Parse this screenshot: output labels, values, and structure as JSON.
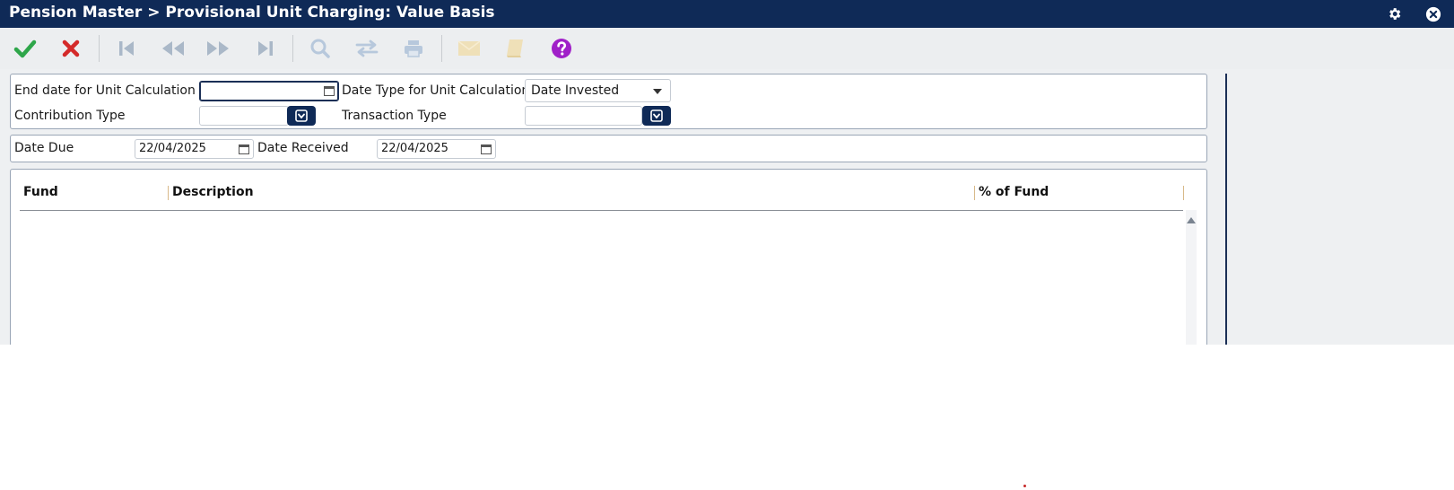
{
  "window": {
    "title": "Pension Master > Provisional Unit Charging: Value Basis"
  },
  "titlebar_icons": [
    "gear-icon",
    "close-circle-icon"
  ],
  "toolbar": {
    "buttons": [
      {
        "name": "accept-button",
        "icon": "checkmark-icon",
        "color": "#2ea64a",
        "enabled": true
      },
      {
        "name": "cancel-button",
        "icon": "x-icon",
        "color": "#d42a2a",
        "enabled": true
      },
      {
        "name": "first-record-button",
        "icon": "skip-first-icon",
        "color": "#aab8c8",
        "enabled": false
      },
      {
        "name": "previous-record-button",
        "icon": "rewind-icon",
        "color": "#aab8c8",
        "enabled": false
      },
      {
        "name": "next-record-button",
        "icon": "fast-forward-icon",
        "color": "#aab8c8",
        "enabled": false
      },
      {
        "name": "last-record-button",
        "icon": "skip-last-icon",
        "color": "#aab8c8",
        "enabled": false
      },
      {
        "name": "search-button",
        "icon": "magnifier-icon",
        "color": "#b7c8dc",
        "enabled": false
      },
      {
        "name": "transfer-button",
        "icon": "swap-arrows-icon",
        "color": "#b7c8dc",
        "enabled": false
      },
      {
        "name": "print-button",
        "icon": "printer-icon",
        "color": "#b7c8dc",
        "enabled": false
      },
      {
        "name": "email-button",
        "icon": "envelope-icon",
        "color": "#efe0b8",
        "enabled": false
      },
      {
        "name": "notes-button",
        "icon": "book-icon",
        "color": "#efe0b8",
        "enabled": false
      },
      {
        "name": "help-button",
        "icon": "question-circle-icon",
        "color": "#a020c8",
        "enabled": true
      }
    ]
  },
  "form": {
    "end_date_label": "End date for Unit Calculation",
    "end_date_value": "",
    "date_type_label": "Date Type for Unit Calculation",
    "date_type_value": "Date Invested",
    "contribution_type_label": "Contribution Type",
    "contribution_type_value": "",
    "transaction_type_label": "Transaction Type",
    "transaction_type_value": "",
    "date_due_label": "Date Due",
    "date_due_value": "22/04/2025",
    "date_received_label": "Date Received",
    "date_received_value": "22/04/2025"
  },
  "grid": {
    "columns": [
      "Fund",
      "Description",
      "% of Fund"
    ],
    "rows": []
  },
  "colors": {
    "titlebar": "#0f2a57",
    "accent_dark_blue": "#0f2a57",
    "column_separator": "#d8b989"
  }
}
